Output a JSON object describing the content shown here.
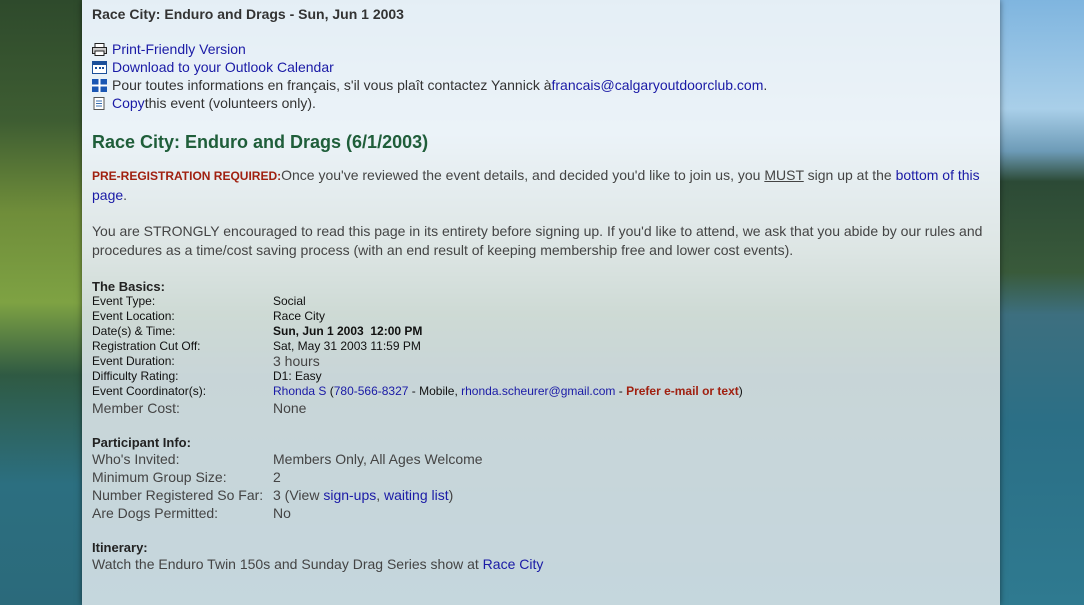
{
  "breadcrumb": "Race City: Enduro and Drags - Sun, Jun 1 2003",
  "actions": {
    "print": "Print-Friendly Version",
    "outlook": "Download to your Outlook Calendar",
    "french_prefix": "Pour toutes informations en français, s'il vous plaît contactez Yannick à ",
    "french_email": "francais@calgaryoutdoorclub.com",
    "french_suffix": ".",
    "copy_link": "Copy",
    "copy_suffix": " this event (volunteers only)."
  },
  "event_title": "Race City: Enduro and Drags (6/1/2003)",
  "prereg": {
    "label": "PRE-REGISTRATION REQUIRED:",
    "text1": "Once you've reviewed the event details, and decided you'd like to join us, you ",
    "must": "MUST",
    "text2": " sign up at the ",
    "link": "bottom of this page",
    "text3": "."
  },
  "encourage": "You are STRONGLY encouraged to read this page in its entirety before signing up. If you'd like to attend, we ask that you abide by our rules and procedures as a time/cost saving process (with an end result of keeping membership free and lower cost events).",
  "basics": {
    "title": "The Basics:",
    "event_type_k": "Event Type:",
    "event_type_v": "Social",
    "location_k": "Event Location:",
    "location_v": "Race City",
    "datetime_k": "Date(s) & Time:",
    "datetime_v": "Sun, Jun 1 2003  12:00 PM",
    "cutoff_k": "Registration Cut Off:",
    "cutoff_v": "Sat, May 31 2003 11:59 PM",
    "duration_k": "Event Duration:",
    "duration_v": "3 hours",
    "difficulty_k": "Difficulty Rating:",
    "difficulty_v": "D1: Easy",
    "coordinator_k": "Event Coordinator(s):",
    "coordinator_name": "Rhonda S",
    "coordinator_phone": "780-566-8327",
    "coordinator_mobile": " - Mobile, ",
    "coordinator_email": "rhonda.scheurer@gmail.com",
    "coordinator_sep": " - ",
    "coordinator_pref": "Prefer e-mail or text",
    "cost_k": "Member Cost:",
    "cost_v": "None"
  },
  "participant": {
    "title": "Participant Info:",
    "invited_k": "Who's Invited:",
    "invited_v": "Members Only, All Ages Welcome",
    "min_k": "Minimum Group Size:",
    "min_v": "2",
    "registered_k": "Number Registered So Far:",
    "registered_v": "3 (View ",
    "signups": "sign-ups",
    "comma": ", ",
    "waiting": "waiting list",
    "close": ")",
    "dogs_k": "Are Dogs Permitted:",
    "dogs_v": "No"
  },
  "itinerary": {
    "title": "Itinerary:",
    "text": "Watch the Enduro Twin 150s and Sunday Drag Series show at ",
    "link": "Race City"
  },
  "colors": {
    "link": "#1a1aa6",
    "title_green": "#1f5e3a",
    "alert_red": "#a02010"
  }
}
